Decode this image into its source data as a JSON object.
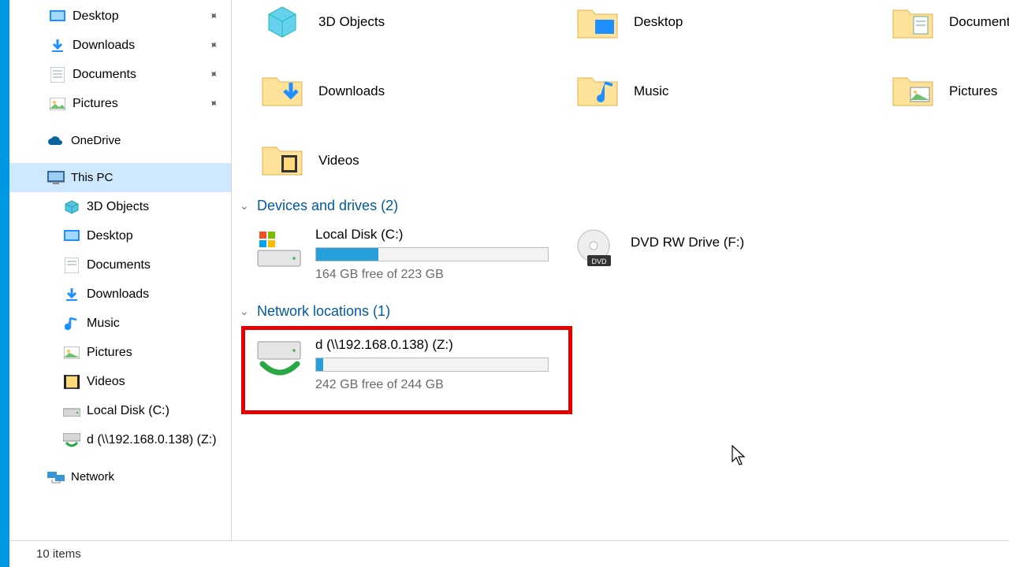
{
  "sidebar": {
    "quick": [
      {
        "label": "Desktop",
        "icon": "desktop",
        "pinned": true
      },
      {
        "label": "Downloads",
        "icon": "downloads",
        "pinned": true
      },
      {
        "label": "Documents",
        "icon": "documents",
        "pinned": true
      },
      {
        "label": "Pictures",
        "icon": "pictures",
        "pinned": true
      }
    ],
    "onedrive": {
      "label": "OneDrive"
    },
    "thispc": {
      "label": "This PC"
    },
    "pcfolders": [
      {
        "label": "3D Objects",
        "icon": "cube"
      },
      {
        "label": "Desktop",
        "icon": "desktop"
      },
      {
        "label": "Documents",
        "icon": "documents"
      },
      {
        "label": "Downloads",
        "icon": "downloads"
      },
      {
        "label": "Music",
        "icon": "music"
      },
      {
        "label": "Pictures",
        "icon": "pictures"
      },
      {
        "label": "Videos",
        "icon": "videos"
      }
    ],
    "drives": [
      {
        "label": "Local Disk (C:)",
        "icon": "hdd"
      },
      {
        "label": "d (\\\\192.168.0.138) (Z:)",
        "icon": "netdrive"
      }
    ],
    "network": {
      "label": "Network"
    }
  },
  "main": {
    "folders": [
      {
        "label": "3D Objects",
        "icon": "cube"
      },
      {
        "label": "Desktop",
        "icon": "desktop-folder"
      },
      {
        "label": "Documents",
        "icon": "documents-folder"
      },
      {
        "label": "Downloads",
        "icon": "downloads-folder"
      },
      {
        "label": "Music",
        "icon": "music-folder"
      },
      {
        "label": "Pictures",
        "icon": "pictures-folder"
      },
      {
        "label": "Videos",
        "icon": "videos-folder"
      }
    ],
    "devices_header": "Devices and drives (2)",
    "devices": [
      {
        "name": "Local Disk (C:)",
        "free": "164 GB free of 223 GB",
        "fill_pct": 27,
        "icon": "oshdd",
        "barless": false
      },
      {
        "name": "DVD RW Drive (F:)",
        "free": "",
        "fill_pct": 0,
        "icon": "dvd",
        "barless": true
      }
    ],
    "network_header": "Network locations (1)",
    "network": [
      {
        "name": "d (\\\\192.168.0.138) (Z:)",
        "free": "242 GB free of 244 GB",
        "fill_pct": 3,
        "icon": "netdrive"
      }
    ]
  },
  "status": {
    "text": "10 items"
  }
}
